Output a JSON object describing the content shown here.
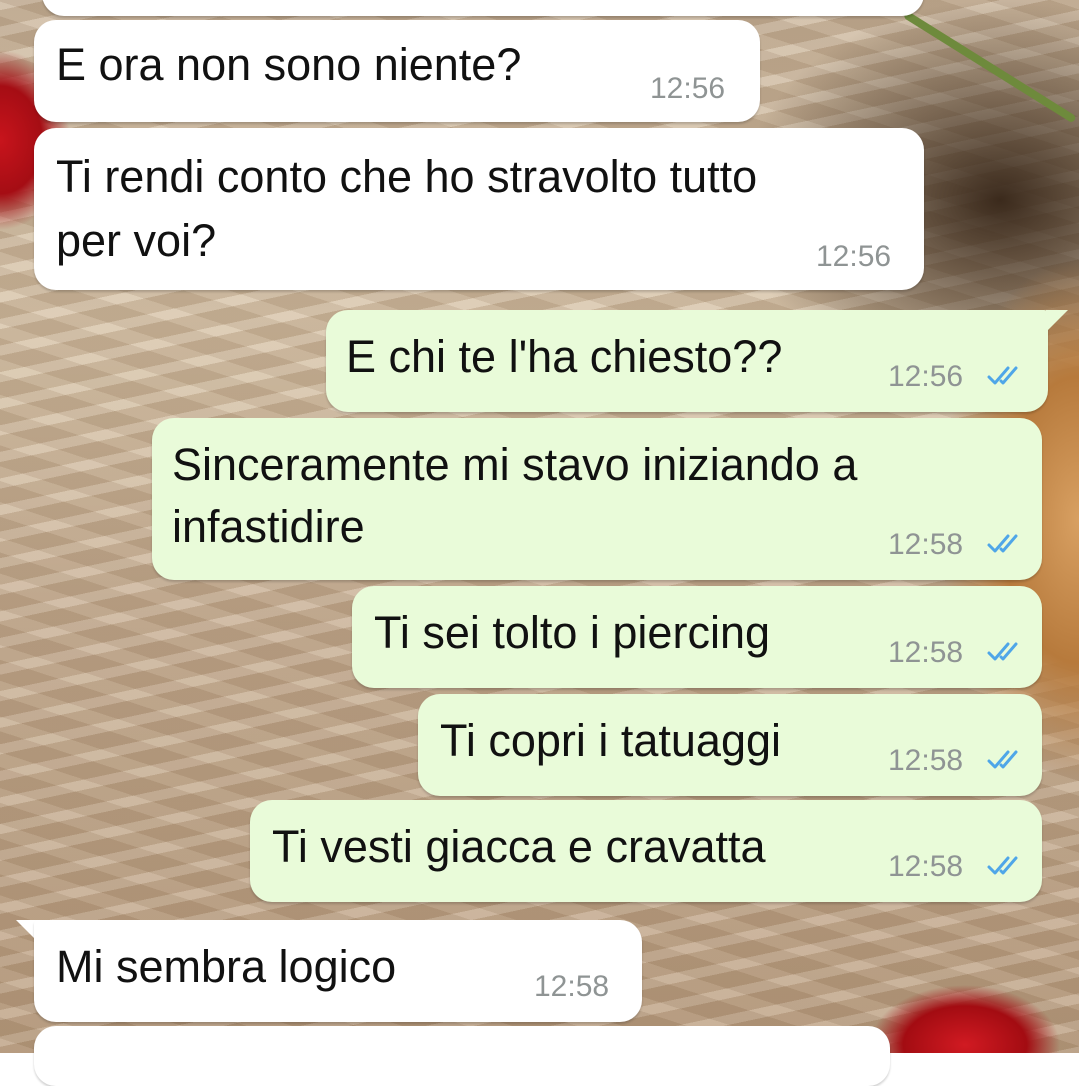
{
  "chat": {
    "messages": [
      {
        "direction": "incoming",
        "text": "E ora non sono niente?",
        "time": "12:56"
      },
      {
        "direction": "incoming",
        "text": "Ti rendi conto che ho stravolto tutto\nper voi?",
        "line1": "Ti rendi conto che ho stravolto tutto",
        "line2": "per voi?",
        "time": "12:56"
      },
      {
        "direction": "outgoing",
        "text": "E chi te l'ha chiesto??",
        "time": "12:56",
        "status": "read"
      },
      {
        "direction": "outgoing",
        "line1": "Sinceramente mi stavo iniziando a",
        "line2": "infastidire",
        "time": "12:58",
        "status": "read"
      },
      {
        "direction": "outgoing",
        "text": "Ti sei tolto i piercing",
        "time": "12:58",
        "status": "read"
      },
      {
        "direction": "outgoing",
        "text": "Ti copri i tatuaggi",
        "time": "12:58",
        "status": "read"
      },
      {
        "direction": "outgoing",
        "text": "Ti vesti giacca e cravatta",
        "time": "12:58",
        "status": "read"
      },
      {
        "direction": "incoming",
        "text": "Mi sembra logico",
        "time": "12:58"
      }
    ]
  },
  "colors": {
    "incoming_bubble": "#ffffff",
    "outgoing_bubble": "#e9fbd9",
    "read_ticks": "#4fa6e8",
    "timestamp": "#8f9494"
  },
  "icons": {
    "read_status": "double-check-icon"
  }
}
